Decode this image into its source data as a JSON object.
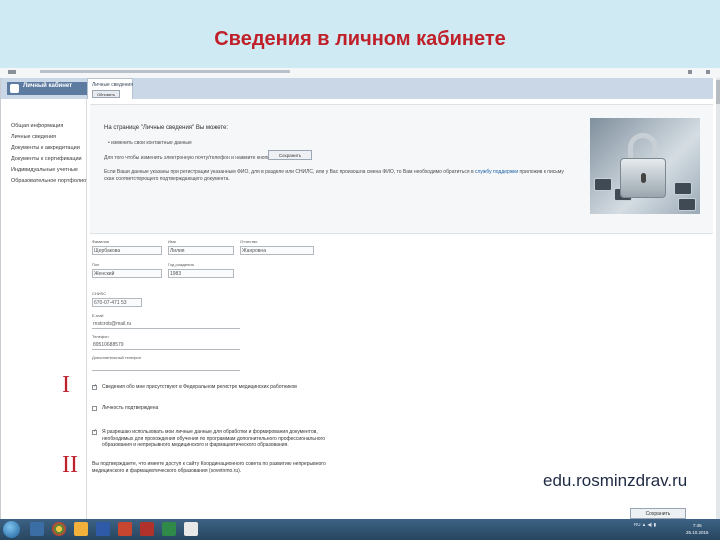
{
  "slide": {
    "title": "Сведения в личном кабинете",
    "site_url": "edu.rosminzdrav.ru",
    "marker_1": "I",
    "marker_2": "II"
  },
  "header": {
    "logo_text": "Личный кабинет",
    "tab_label": "Личные сведения",
    "update_button": "Обновить"
  },
  "sidebar": {
    "items": [
      "Общая информация",
      "Личные сведения",
      "Документы к аккредитации",
      "Документы к сертификации",
      "Индивидуальные учетные",
      "Образовательное портфолио"
    ]
  },
  "info": {
    "heading": "На странице \"Личные сведения\" Вы можете:",
    "bullet": "изменить свои контактные данные",
    "text1": "Для того чтобы изменить электронную почту/телефон и нажмите кнопку",
    "save_top": "Сохранить",
    "text2_prefix": "Если Ваши данные указаны при регистрации указанным ФИО, для в разделе или СНИЛС, или у Вас произошла смена ФИО, то Вам необходимо обратиться в",
    "text2_link": "службу",
    "text2_link2": "поддержки",
    "text2_suffix": "приложив к письму скан соответствующего подтверждающего документа."
  },
  "form": {
    "surname_label": "Фамилия",
    "surname_value": "Щербакова",
    "name_label": "Имя",
    "name_value": "Лилия",
    "patronymic_label": "Отчество",
    "patronymic_value": "Жанровна",
    "gender_label": "Пол",
    "gender_value": "Женский",
    "birth_label": "Год рождения",
    "birth_value": "1983",
    "snils_label": "СНИЛС",
    "snils_value": "670-07-471 53",
    "email_label": "E-mail",
    "email_value": "rnstcrob@mail.ru",
    "phone_label": "Телефон",
    "phone_value": "89510688579",
    "extra_phone_label": "Дополнительный телефон"
  },
  "checks": {
    "c1": "Сведения обо мне присутствуют в Федеральном регистре медицинских работников",
    "c2": "Личность подтверждена",
    "c3": "Я разрешаю использовать мои личные данные для обработки и формирования документов, необходимых для прохождения обучения по программам дополнительного профессионального образования и непрерывного медицинского и фармацевтического образования."
  },
  "bottom": {
    "text": "Вы подтверждаете, что имеете доступ к сайту Координационного совета по развитию непрерывного медицинского и фармацевтического образования (sovetnmo.ru).",
    "save_button": "Сохранить"
  },
  "taskbar": {
    "tray": "RU ▲ ◀) ▮",
    "time": "7:45",
    "date": "25.10.2016"
  }
}
